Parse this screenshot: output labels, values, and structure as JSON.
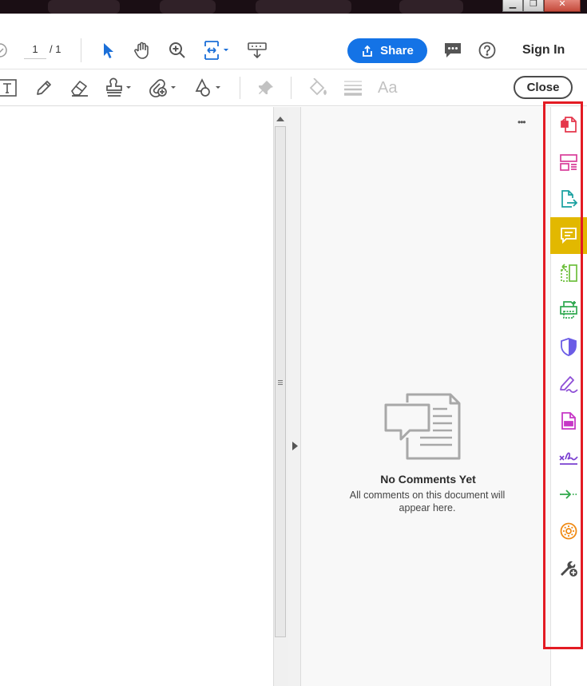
{
  "window": {
    "minimize_glyph": "▁",
    "restore_glyph": "❐",
    "close_glyph": "✕"
  },
  "page_nav": {
    "current": "1",
    "total": "/ 1"
  },
  "header": {
    "share_label": "Share",
    "sign_in_label": "Sign In"
  },
  "comment_toolbar": {
    "close_label": "Close",
    "text_tool_label": "Aa"
  },
  "comments_panel": {
    "more_glyph": "•••",
    "empty_title": "No Comments Yet",
    "empty_description": "All comments on this document will appear here."
  },
  "right_rail": {
    "highlight_color": "#e31b23",
    "active_color": "#e2b800",
    "tools": [
      {
        "icon": "create-pdf-icon",
        "color": "#e5364b"
      },
      {
        "icon": "organize-pages-icon",
        "color": "#d83e9a"
      },
      {
        "icon": "export-pdf-icon",
        "color": "#18a0a0"
      },
      {
        "icon": "comment-icon",
        "color": "#ffffff",
        "active": true
      },
      {
        "icon": "combine-files-icon",
        "color": "#6cbf3b"
      },
      {
        "icon": "print-production-icon",
        "color": "#2ea84f"
      },
      {
        "icon": "protect-icon",
        "color": "#6b5ce6"
      },
      {
        "icon": "fill-sign-icon",
        "color": "#8e4fd6"
      },
      {
        "icon": "prepare-form-icon",
        "color": "#c637c6"
      },
      {
        "icon": "request-signatures-icon",
        "color": "#7a3fd1"
      },
      {
        "icon": "send-for-review-icon",
        "color": "#2fa84a"
      },
      {
        "icon": "action-wizard-icon",
        "color": "#f08a14"
      },
      {
        "icon": "more-tools-icon",
        "color": "#4b4b4b"
      }
    ]
  }
}
